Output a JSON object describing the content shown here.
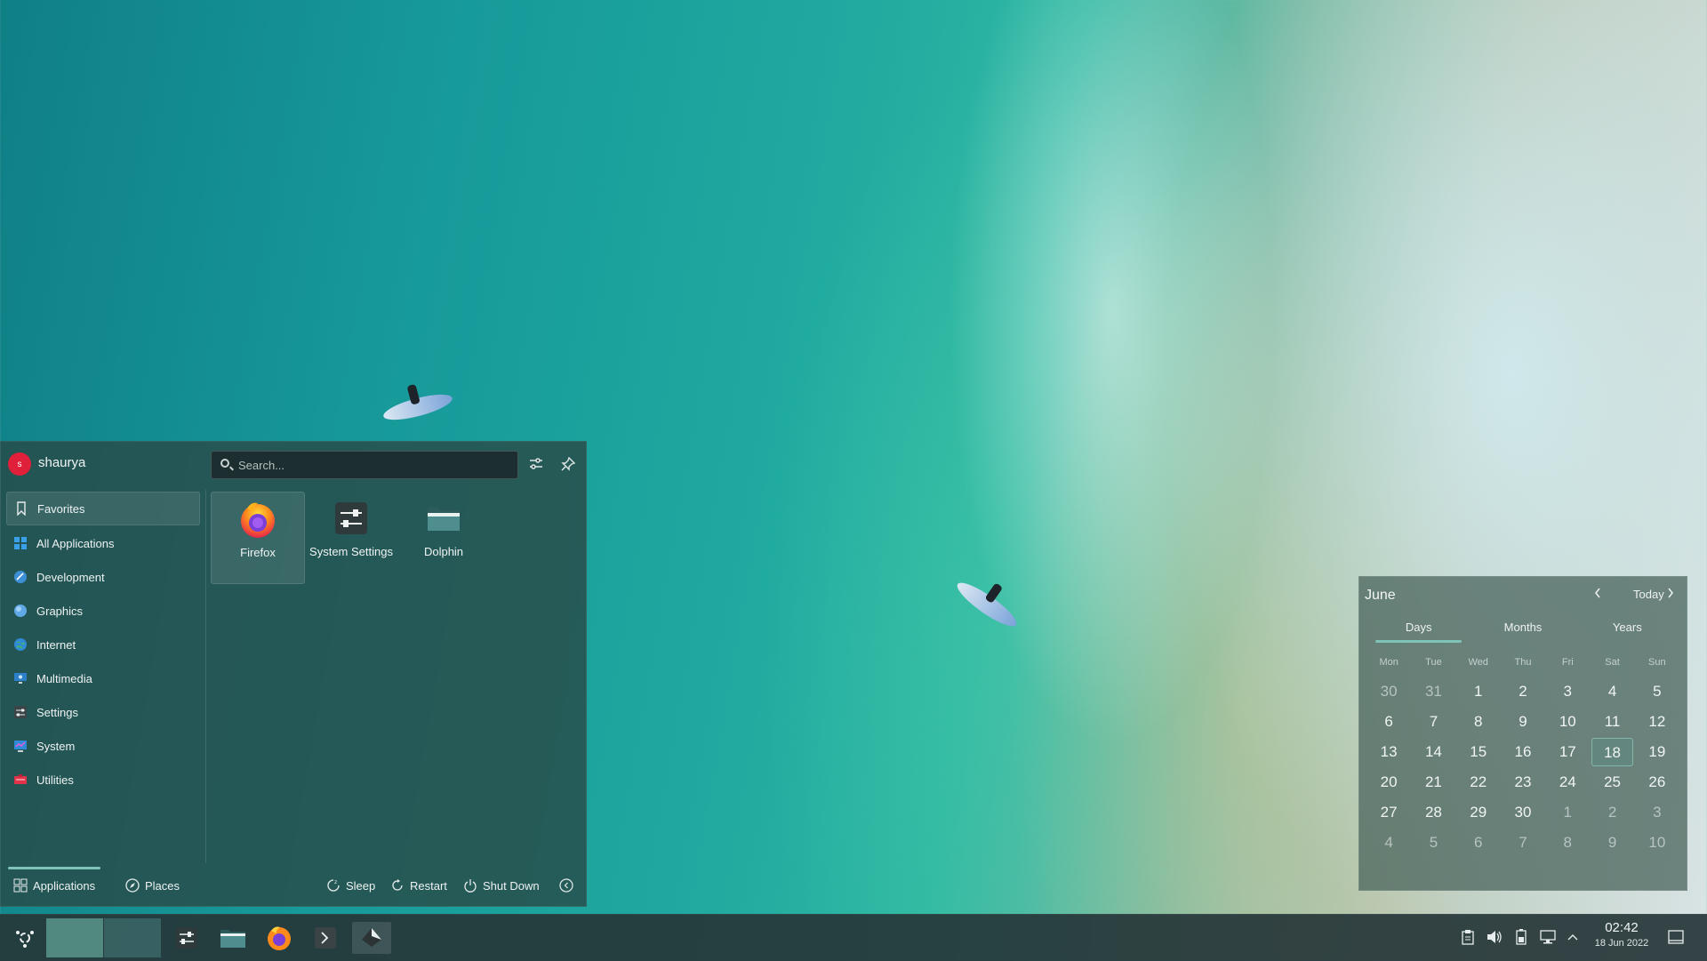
{
  "launcher": {
    "username": "shaurya",
    "avatar_letter": "s",
    "search_placeholder": "Search...",
    "categories": [
      {
        "label": "Favorites",
        "icon": "bookmark-icon"
      },
      {
        "label": "All Applications",
        "icon": "grid-icon"
      },
      {
        "label": "Development",
        "icon": "development-icon"
      },
      {
        "label": "Graphics",
        "icon": "graphics-icon"
      },
      {
        "label": "Internet",
        "icon": "globe-icon"
      },
      {
        "label": "Multimedia",
        "icon": "multimedia-icon"
      },
      {
        "label": "Settings",
        "icon": "settings-icon"
      },
      {
        "label": "System",
        "icon": "system-icon"
      },
      {
        "label": "Utilities",
        "icon": "utilities-icon"
      }
    ],
    "apps": [
      {
        "label": "Firefox",
        "icon": "firefox-icon"
      },
      {
        "label": "System Settings",
        "icon": "system-settings-icon"
      },
      {
        "label": "Dolphin",
        "icon": "dolphin-folder-icon"
      }
    ],
    "footer": {
      "applications": "Applications",
      "places": "Places",
      "sleep": "Sleep",
      "restart": "Restart",
      "shutdown": "Shut Down"
    }
  },
  "calendar": {
    "month": "June",
    "today_label": "Today",
    "tabs": [
      "Days",
      "Months",
      "Years"
    ],
    "weekdays": [
      "Mon",
      "Tue",
      "Wed",
      "Thu",
      "Fri",
      "Sat",
      "Sun"
    ],
    "days": [
      {
        "d": "30",
        "dim": true
      },
      {
        "d": "31",
        "dim": true
      },
      {
        "d": "1"
      },
      {
        "d": "2"
      },
      {
        "d": "3"
      },
      {
        "d": "4"
      },
      {
        "d": "5"
      },
      {
        "d": "6"
      },
      {
        "d": "7"
      },
      {
        "d": "8"
      },
      {
        "d": "9"
      },
      {
        "d": "10"
      },
      {
        "d": "11"
      },
      {
        "d": "12"
      },
      {
        "d": "13"
      },
      {
        "d": "14"
      },
      {
        "d": "15"
      },
      {
        "d": "16"
      },
      {
        "d": "17"
      },
      {
        "d": "18",
        "today": true
      },
      {
        "d": "19"
      },
      {
        "d": "20"
      },
      {
        "d": "21"
      },
      {
        "d": "22"
      },
      {
        "d": "23"
      },
      {
        "d": "24"
      },
      {
        "d": "25"
      },
      {
        "d": "26"
      },
      {
        "d": "27"
      },
      {
        "d": "28"
      },
      {
        "d": "29"
      },
      {
        "d": "30"
      },
      {
        "d": "1",
        "dim": true
      },
      {
        "d": "2",
        "dim": true
      },
      {
        "d": "3",
        "dim": true
      },
      {
        "d": "4",
        "dim": true
      },
      {
        "d": "5",
        "dim": true
      },
      {
        "d": "6",
        "dim": true
      },
      {
        "d": "7",
        "dim": true
      },
      {
        "d": "8",
        "dim": true
      },
      {
        "d": "9",
        "dim": true
      },
      {
        "d": "10",
        "dim": true
      }
    ]
  },
  "taskbar": {
    "clock_time": "02:42",
    "clock_date": "18 Jun 2022"
  },
  "colors": {
    "accent": "#7ec3b8",
    "avatar": "#e0203a"
  }
}
